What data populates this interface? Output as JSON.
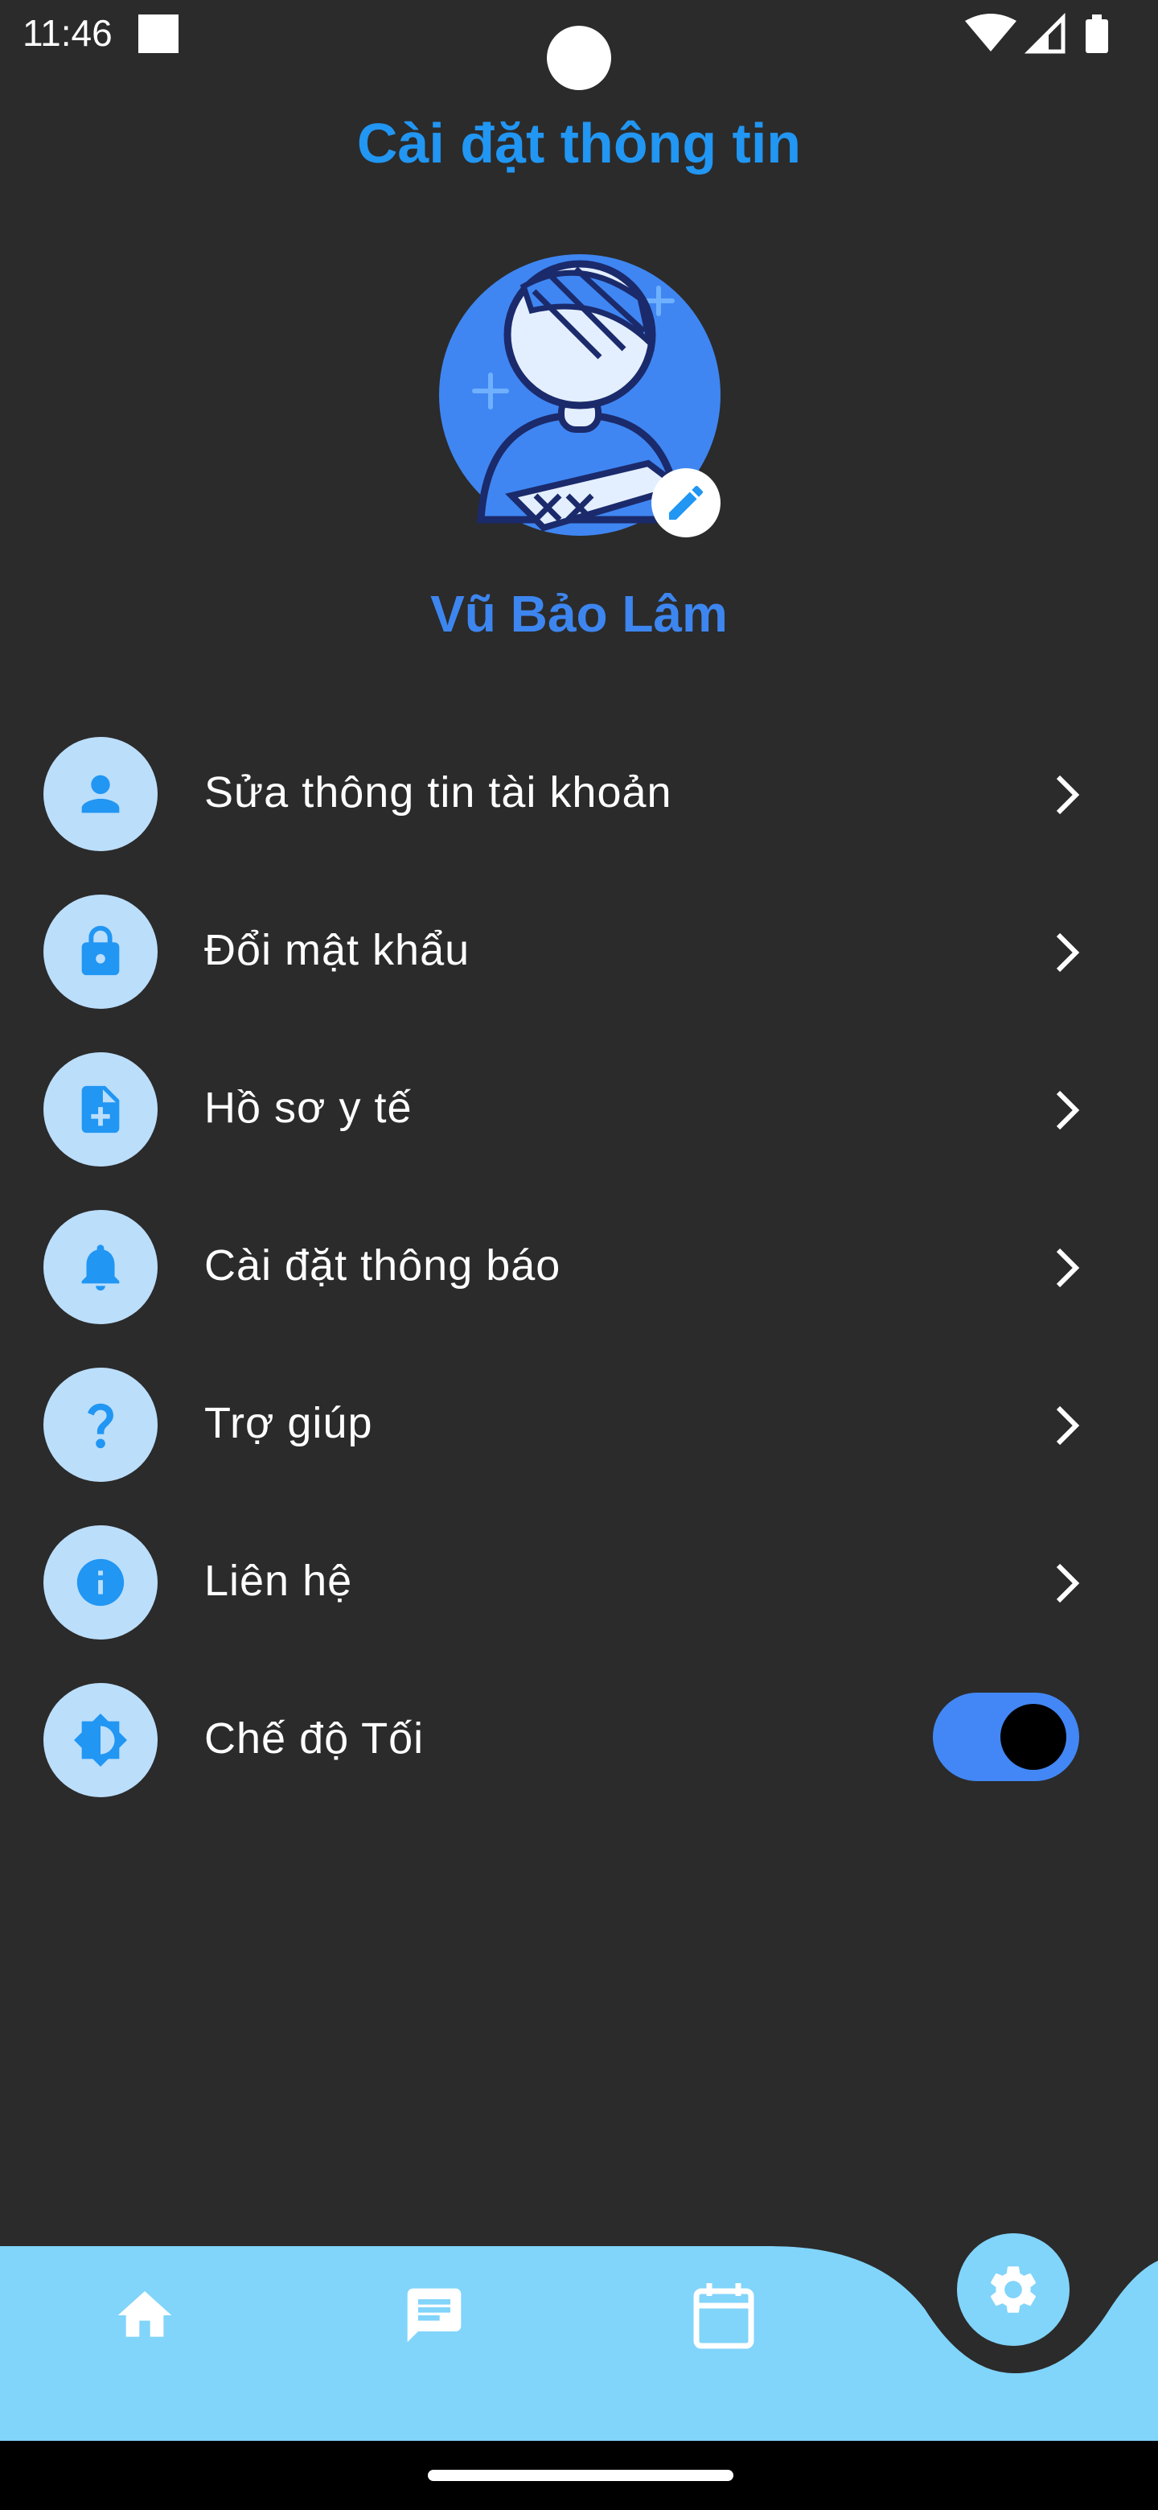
{
  "status_bar": {
    "time": "11:46",
    "icons": [
      "wifi-icon",
      "signal-icon",
      "battery-icon"
    ]
  },
  "header": {
    "title": "Cài đặt thông tin"
  },
  "profile": {
    "name": "Vũ Bảo Lâm",
    "avatar_icon": "injured-person-avatar",
    "edit_icon": "pencil-icon"
  },
  "menu": {
    "items": [
      {
        "label": "Sửa thông tin tài khoản",
        "icon": "person-icon"
      },
      {
        "label": "Đổi mật khẩu",
        "icon": "lock-icon"
      },
      {
        "label": "Hồ sơ y tế",
        "icon": "medical-file-icon"
      },
      {
        "label": "Cài đặt thông báo",
        "icon": "bell-icon"
      },
      {
        "label": "Trợ giúp",
        "icon": "question-icon"
      },
      {
        "label": "Liên hệ",
        "icon": "info-icon"
      },
      {
        "label": "Chế độ Tối",
        "icon": "brightness-icon"
      }
    ],
    "dark_mode_enabled": true
  },
  "bottom_nav": {
    "items": [
      "home-icon",
      "chat-icon",
      "calendar-icon",
      "settings-icon"
    ],
    "active": "settings-icon"
  },
  "colors": {
    "background": "#2b2b2b",
    "accent": "#2196f3",
    "icon_circle": "#bbdefb",
    "nav_bar": "#81d4fa",
    "toggle_on": "#4287f5"
  }
}
